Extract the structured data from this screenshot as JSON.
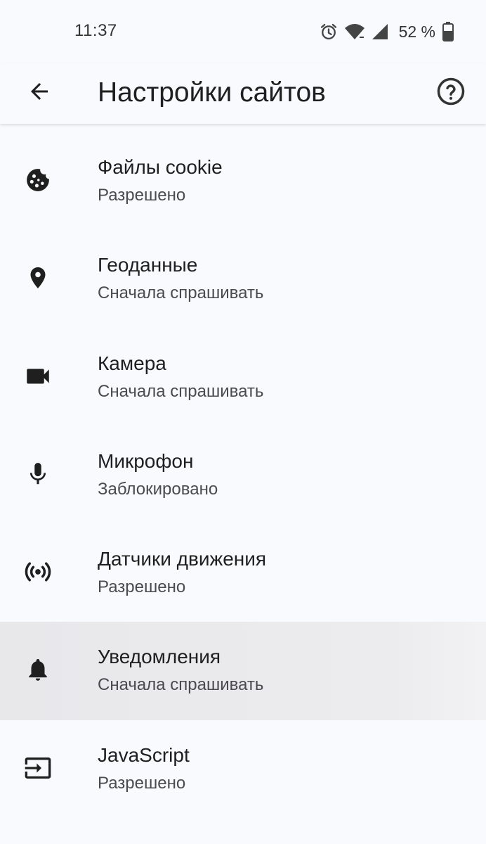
{
  "status_bar": {
    "time": "11:37",
    "battery_percent": "52 %",
    "icons": [
      "alarm-icon",
      "wifi-icon",
      "cell-signal-icon",
      "battery-icon"
    ]
  },
  "app_bar": {
    "title": "Настройки сайтов",
    "back_icon": "arrow-back-icon",
    "help_icon": "help-circle-icon"
  },
  "settings": {
    "items": [
      {
        "icon": "cookie-icon",
        "title": "Файлы cookie",
        "status": "Разрешено"
      },
      {
        "icon": "location-pin-icon",
        "title": "Геоданные",
        "status": "Сначала спрашивать"
      },
      {
        "icon": "videocam-icon",
        "title": "Камера",
        "status": "Сначала спрашивать"
      },
      {
        "icon": "microphone-icon",
        "title": "Микрофон",
        "status": "Заблокировано"
      },
      {
        "icon": "motion-sensors-icon",
        "title": "Датчики движения",
        "status": "Разрешено"
      },
      {
        "icon": "bell-icon",
        "title": "Уведомления",
        "status": "Сначала спрашивать",
        "highlighted": true
      },
      {
        "icon": "javascript-input-icon",
        "title": "JavaScript",
        "status": "Разрешено"
      }
    ]
  },
  "colors": {
    "background": "#f9fafd",
    "text_primary": "#1f1f1f",
    "text_secondary": "#4a4a4f",
    "highlight_row": "#e9e9ec",
    "icon": "#1f1f1f"
  }
}
